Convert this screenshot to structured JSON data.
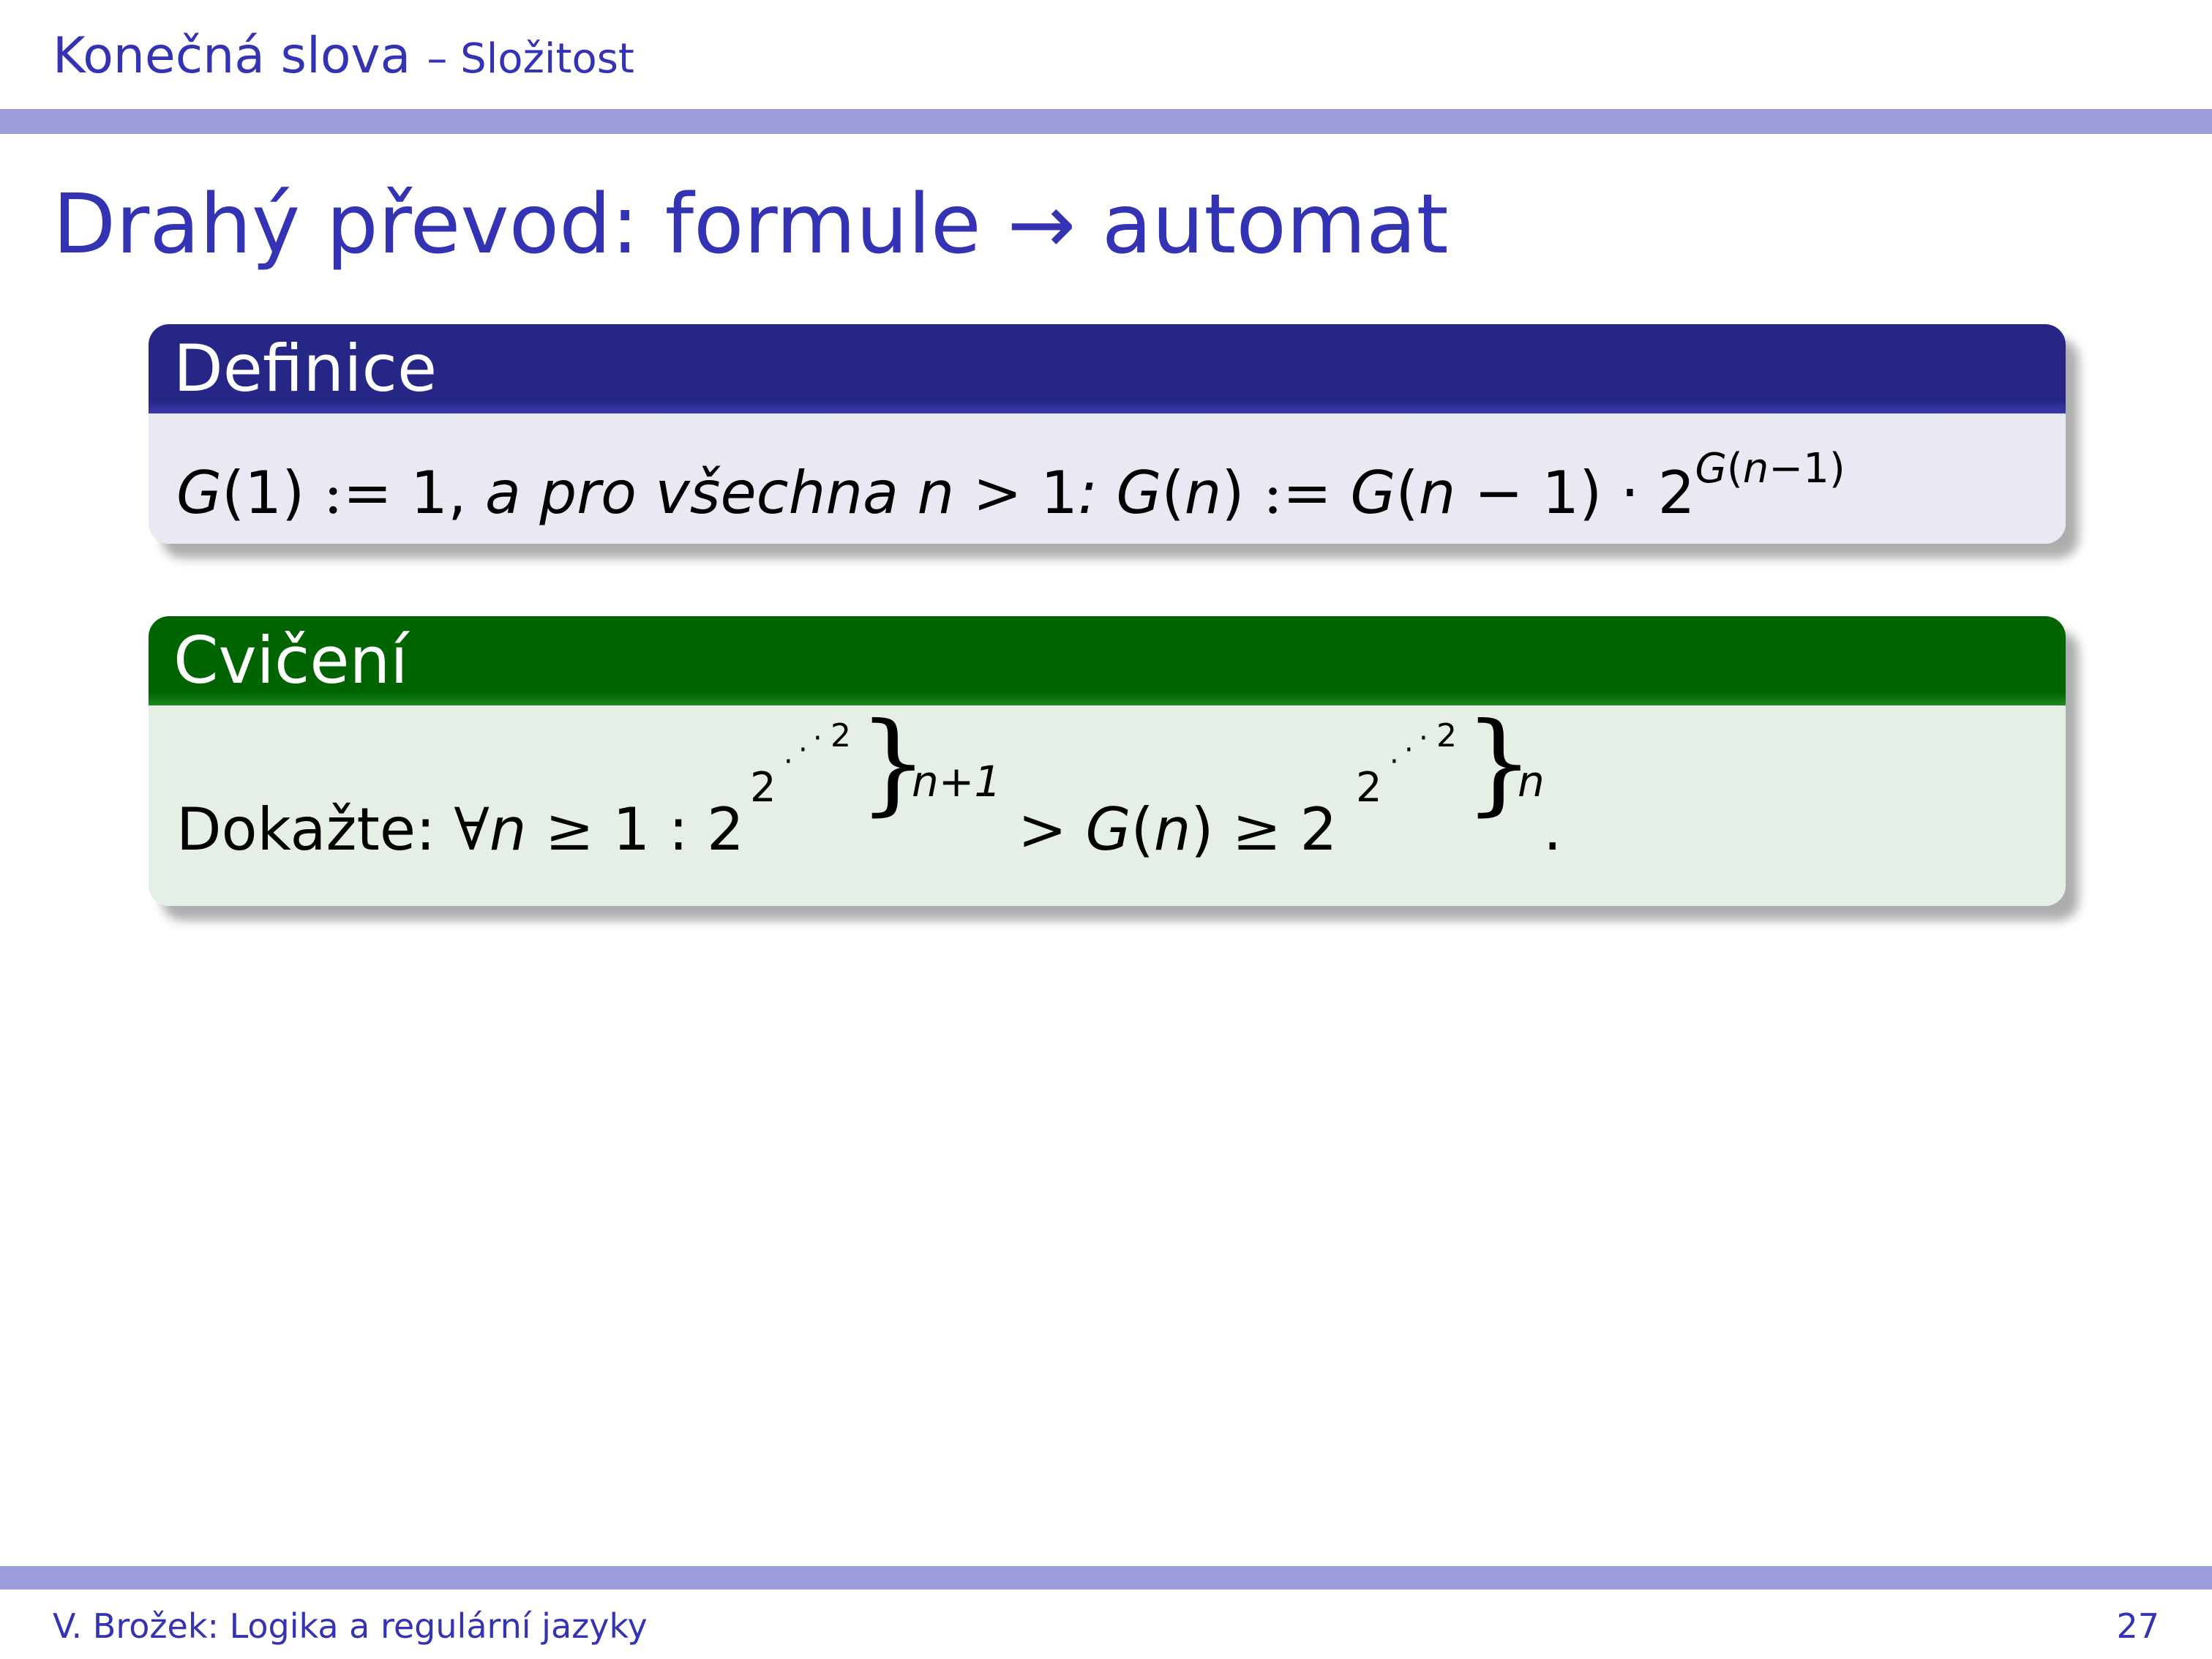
{
  "header": {
    "section": "Konečná slova",
    "subsection": "– Složitost"
  },
  "frame": {
    "title": "Drahý převod: formule → automat"
  },
  "definition_block": {
    "title": "Definice",
    "formula": "G(1) := 1, a pro všechna n > 1: G(n) := G(n − 1) · 2^G(n−1)"
  },
  "exercise_block": {
    "title": "Cvičení",
    "formula": "Dokažte: ∀n ≥ 1 : 2^2^…^2 }n+1 > G(n) ≥ 2^2^…^2 }n."
  },
  "footer": {
    "author_title": "V. Brožek: Logika a regulární jazyky",
    "page_number": "27"
  },
  "colors": {
    "theme_blue": "#3333b3",
    "bar": "#9d9ddb",
    "definition_header": "#262686",
    "definition_body": "#e9e9f4",
    "exercise_header": "#006400",
    "exercise_body": "#e5efe5"
  }
}
